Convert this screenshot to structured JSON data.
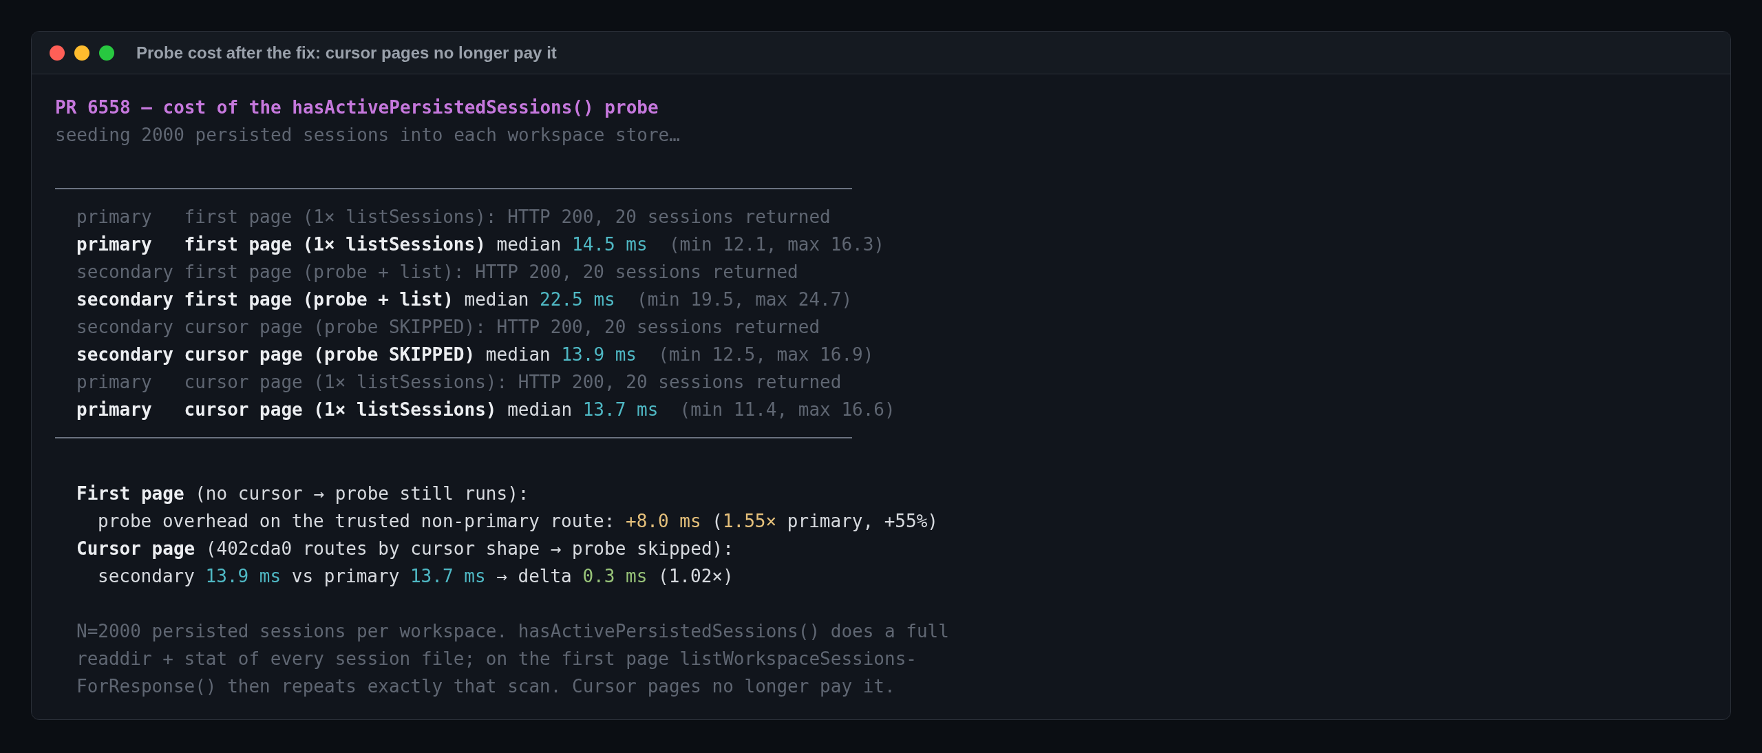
{
  "window": {
    "title": "Probe cost after the fix: cursor pages no longer pay it"
  },
  "intro": [
    {
      "segments": [
        {
          "text": "PR 6558 — cost of the hasActivePersistedSessions() probe",
          "kind": "heading"
        }
      ]
    },
    {
      "segments": [
        {
          "text": "seeding 2000 persisted sessions into each workspace store…",
          "kind": "muted"
        }
      ]
    }
  ],
  "results": [
    {
      "segments": [
        {
          "text": "primary   first page (1× listSessions): HTTP 200, 20 sessions returned",
          "kind": "muted"
        }
      ]
    },
    {
      "segments": [
        {
          "text": "primary   first page (1× listSessions)",
          "kind": "label"
        },
        {
          "text": " median ",
          "kind": "text"
        },
        {
          "text": "14.5 ms",
          "kind": "timing"
        },
        {
          "text": "  (min 12.1, max 16.3)",
          "kind": "muted"
        }
      ]
    },
    {
      "segments": [
        {
          "text": "secondary first page (probe + list): HTTP 200, 20 sessions returned",
          "kind": "muted"
        }
      ]
    },
    {
      "segments": [
        {
          "text": "secondary first page (probe + list)",
          "kind": "label"
        },
        {
          "text": " median ",
          "kind": "text"
        },
        {
          "text": "22.5 ms",
          "kind": "timing"
        },
        {
          "text": "  (min 19.5, max 24.7)",
          "kind": "muted"
        }
      ]
    },
    {
      "segments": [
        {
          "text": "secondary cursor page (probe SKIPPED): HTTP 200, 20 sessions returned",
          "kind": "muted"
        }
      ]
    },
    {
      "segments": [
        {
          "text": "secondary cursor page (probe SKIPPED)",
          "kind": "label"
        },
        {
          "text": " median ",
          "kind": "text"
        },
        {
          "text": "13.9 ms",
          "kind": "timing"
        },
        {
          "text": "  (min 12.5, max 16.9)",
          "kind": "muted"
        }
      ]
    },
    {
      "segments": [
        {
          "text": "primary   cursor page (1× listSessions): HTTP 200, 20 sessions returned",
          "kind": "muted"
        }
      ]
    },
    {
      "segments": [
        {
          "text": "primary   cursor page (1× listSessions)",
          "kind": "label"
        },
        {
          "text": " median ",
          "kind": "text"
        },
        {
          "text": "13.7 ms",
          "kind": "timing"
        },
        {
          "text": "  (min 11.4, max 16.6)",
          "kind": "muted"
        }
      ]
    }
  ],
  "summary": [
    {
      "segments": [
        {
          "text": "First page",
          "kind": "label"
        },
        {
          "text": " (no cursor → probe still runs):",
          "kind": "text"
        }
      ],
      "children": [
        {
          "segments": [
            {
              "text": "probe overhead on the trusted non-primary route: ",
              "kind": "text"
            },
            {
              "text": "+8.0 ms",
              "kind": "overhead"
            },
            {
              "text": " (",
              "kind": "text"
            },
            {
              "text": "1.55×",
              "kind": "overhead"
            },
            {
              "text": " primary, +55%)",
              "kind": "text"
            }
          ]
        }
      ]
    },
    {
      "segments": [
        {
          "text": "Cursor page",
          "kind": "label"
        },
        {
          "text": " (402cda0 routes by cursor shape → probe skipped):",
          "kind": "text"
        }
      ],
      "children": [
        {
          "segments": [
            {
              "text": "secondary ",
              "kind": "text"
            },
            {
              "text": "13.9 ms",
              "kind": "timing"
            },
            {
              "text": " vs primary ",
              "kind": "text"
            },
            {
              "text": "13.7 ms",
              "kind": "timing"
            },
            {
              "text": " → delta ",
              "kind": "text"
            },
            {
              "text": "0.3 ms",
              "kind": "delta"
            },
            {
              "text": " (1.02×)",
              "kind": "text"
            }
          ]
        }
      ]
    }
  ],
  "note": [
    {
      "segments": [
        {
          "text": "N=2000 persisted sessions per workspace. hasActivePersistedSessions() does a full",
          "kind": "muted"
        }
      ]
    },
    {
      "segments": [
        {
          "text": "readdir + stat of every session file; on the first page listWorkspaceSessions-",
          "kind": "muted"
        }
      ]
    },
    {
      "segments": [
        {
          "text": "ForResponse() then repeats exactly that scan. Cursor pages no longer pay it.",
          "kind": "muted"
        }
      ]
    }
  ]
}
